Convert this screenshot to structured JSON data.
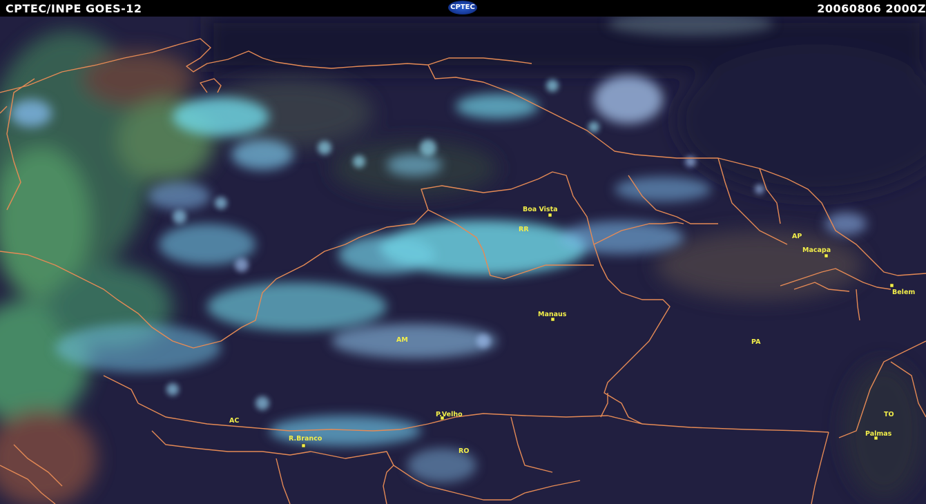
{
  "header": {
    "left_title": "CPTEC/INPE GOES-12",
    "logo_text": "CPTEC",
    "right_title": "20060806 2000Z"
  },
  "colors": {
    "background": "#21203f",
    "cloud_cyan": "#6fd9e8",
    "vegetation_green": "#4fb070",
    "border_orange": "#e58a55",
    "label_yellow": "#f2ee4a"
  },
  "map": {
    "cities": [
      {
        "name": "Boa Vista"
      },
      {
        "name": "Macapa"
      },
      {
        "name": "Belem"
      },
      {
        "name": "Manaus"
      },
      {
        "name": "P.Velho"
      },
      {
        "name": "R.Branco"
      },
      {
        "name": "Palmas"
      }
    ],
    "states": [
      {
        "name": "RR"
      },
      {
        "name": "AP"
      },
      {
        "name": "AM"
      },
      {
        "name": "PA"
      },
      {
        "name": "AC"
      },
      {
        "name": "RO"
      },
      {
        "name": "TO"
      }
    ]
  }
}
